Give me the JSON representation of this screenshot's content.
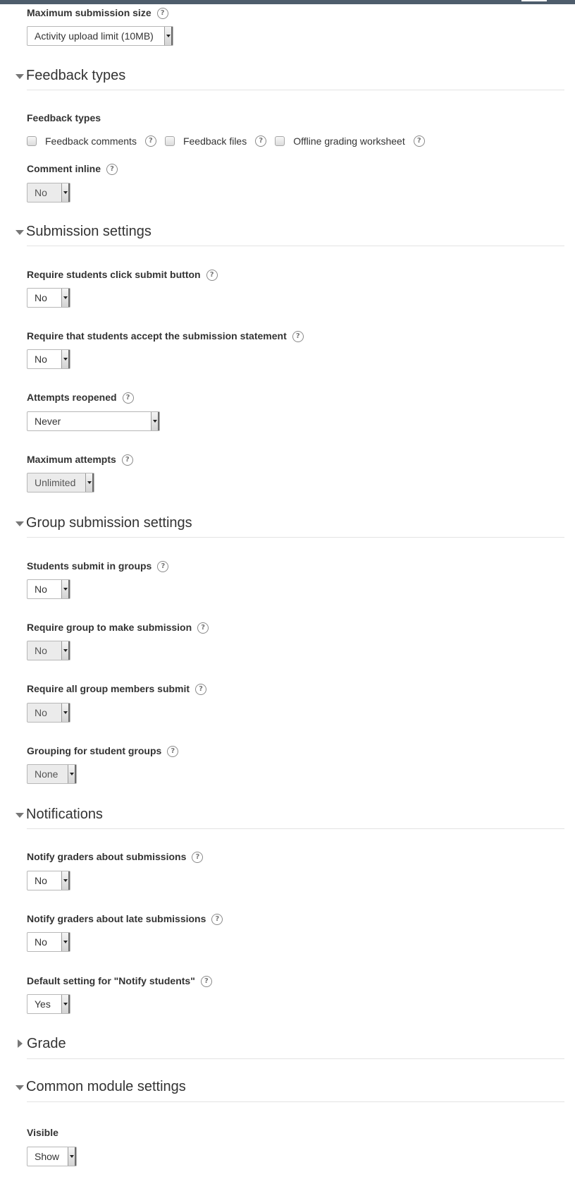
{
  "max_submission_size": {
    "label": "Maximum submission size",
    "value": "Activity upload limit (10MB)"
  },
  "feedback_types_section": {
    "title": "Feedback types",
    "group_label": "Feedback types",
    "options": [
      "Feedback comments",
      "Feedback files",
      "Offline grading worksheet"
    ],
    "comment_inline": {
      "label": "Comment inline",
      "value": "No"
    }
  },
  "submission_settings": {
    "title": "Submission settings",
    "click_submit": {
      "label": "Require students click submit button",
      "value": "No"
    },
    "accept_statement": {
      "label": "Require that students accept the submission statement",
      "value": "No"
    },
    "attempts_reopened": {
      "label": "Attempts reopened",
      "value": "Never"
    },
    "max_attempts": {
      "label": "Maximum attempts",
      "value": "Unlimited"
    }
  },
  "group_submission": {
    "title": "Group submission settings",
    "submit_in_groups": {
      "label": "Students submit in groups",
      "value": "No"
    },
    "group_make_submission": {
      "label": "Require group to make submission",
      "value": "No"
    },
    "all_members_submit": {
      "label": "Require all group members submit",
      "value": "No"
    },
    "grouping": {
      "label": "Grouping for student groups",
      "value": "None"
    }
  },
  "notifications": {
    "title": "Notifications",
    "notify_submissions": {
      "label": "Notify graders about submissions",
      "value": "No"
    },
    "notify_late": {
      "label": "Notify graders about late submissions",
      "value": "No"
    },
    "notify_students": {
      "label": "Default setting for \"Notify students\"",
      "value": "Yes"
    }
  },
  "grade": {
    "title": "Grade"
  },
  "common_module": {
    "title": "Common module settings",
    "visible": {
      "label": "Visible",
      "value": "Show"
    }
  }
}
